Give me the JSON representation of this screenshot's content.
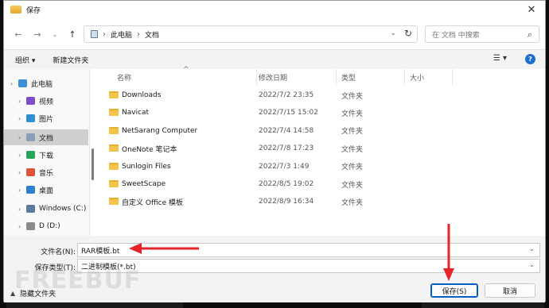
{
  "window": {
    "title": "保存"
  },
  "nav": {
    "path": [
      "此电脑",
      "文档"
    ],
    "search_placeholder": "在 文档 中搜索"
  },
  "toolbar": {
    "organize": "组织 ▾",
    "new_folder": "新建文件夹"
  },
  "sidebar": {
    "items": [
      {
        "label": "此电脑",
        "icon": "pc-icon",
        "color": "#3a8fd6"
      },
      {
        "label": "视频",
        "icon": "video-icon",
        "color": "#7b4fc9"
      },
      {
        "label": "图片",
        "icon": "pictures-icon",
        "color": "#2f8fd1"
      },
      {
        "label": "文档",
        "icon": "documents-icon",
        "color": "#8aa0b8",
        "selected": true
      },
      {
        "label": "下载",
        "icon": "downloads-icon",
        "color": "#2aa35d"
      },
      {
        "label": "音乐",
        "icon": "music-icon",
        "color": "#e0533a"
      },
      {
        "label": "桌面",
        "icon": "desktop-icon",
        "color": "#2f7fd1"
      },
      {
        "label": "Windows (C:)",
        "icon": "drive-icon",
        "color": "#5a7b99"
      },
      {
        "label": "D (D:)",
        "icon": "drive-icon",
        "color": "#8b8b8b"
      }
    ]
  },
  "filelist": {
    "columns": [
      "名称",
      "修改日期",
      "类型",
      "大小"
    ],
    "rows": [
      {
        "name": "Downloads",
        "date": "2022/7/2 23:35",
        "type": "文件夹"
      },
      {
        "name": "Navicat",
        "date": "2022/7/15 15:02",
        "type": "文件夹"
      },
      {
        "name": "NetSarang Computer",
        "date": "2022/7/4 14:58",
        "type": "文件夹"
      },
      {
        "name": "OneNote 笔记本",
        "date": "2022/7/8 17:23",
        "type": "文件夹"
      },
      {
        "name": "Sunlogin Files",
        "date": "2022/7/3 1:49",
        "type": "文件夹"
      },
      {
        "name": "SweetScape",
        "date": "2022/8/5 19:02",
        "type": "文件夹"
      },
      {
        "name": "自定义 Office 模板",
        "date": "2022/8/9 16:34",
        "type": "文件夹"
      }
    ]
  },
  "form": {
    "filename_label": "文件名(N):",
    "filename_value": "RAR模板.bt",
    "filetype_label": "保存类型(T):",
    "filetype_value": "二进制模板(*.bt)"
  },
  "footer": {
    "hide_folders": "隐藏文件夹",
    "save": "保存(S)",
    "cancel": "取消"
  },
  "watermark": "FREEBUF",
  "colors": {
    "accent": "#0060c0",
    "annotation_red": "#e8232a",
    "folder": "#f3c44a"
  }
}
